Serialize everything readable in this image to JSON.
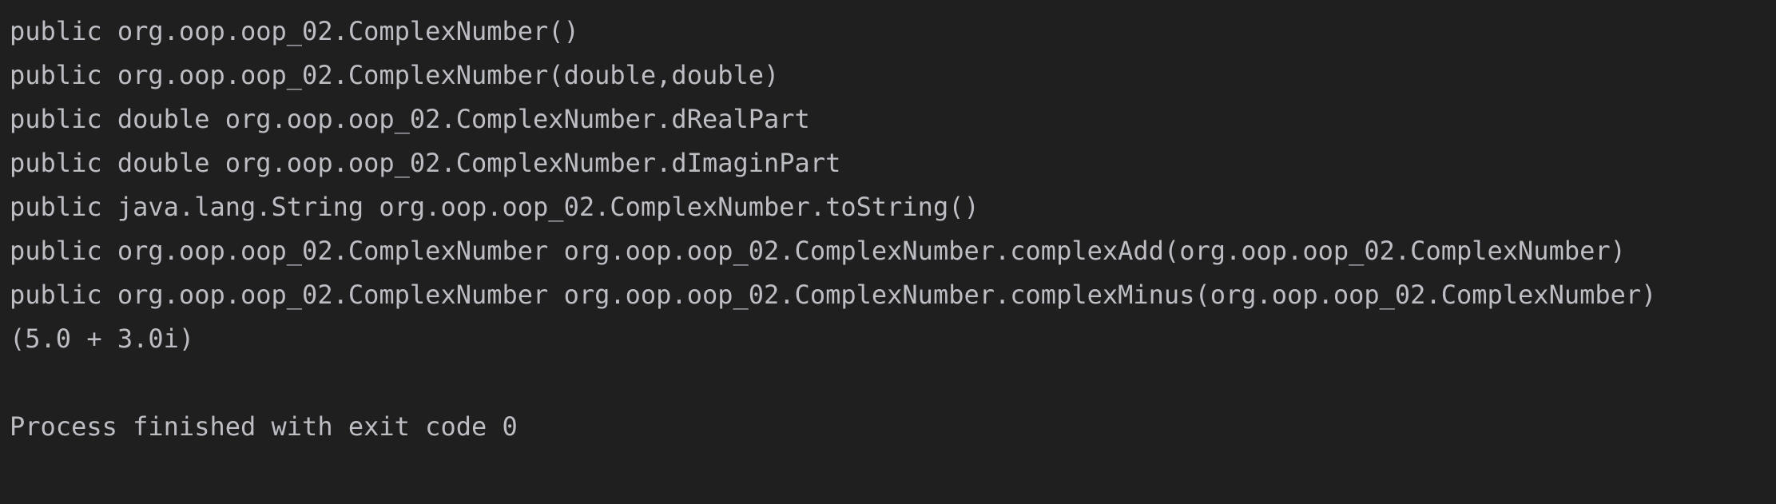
{
  "console": {
    "lines": [
      "public org.oop.oop_02.ComplexNumber()",
      "public org.oop.oop_02.ComplexNumber(double,double)",
      "public double org.oop.oop_02.ComplexNumber.dRealPart",
      "public double org.oop.oop_02.ComplexNumber.dImaginPart",
      "public java.lang.String org.oop.oop_02.ComplexNumber.toString()",
      "public org.oop.oop_02.ComplexNumber org.oop.oop_02.ComplexNumber.complexAdd(org.oop.oop_02.ComplexNumber)",
      "public org.oop.oop_02.ComplexNumber org.oop.oop_02.ComplexNumber.complexMinus(org.oop.oop_02.ComplexNumber)",
      "(5.0 + 3.0i)",
      "",
      "Process finished with exit code 0"
    ]
  }
}
